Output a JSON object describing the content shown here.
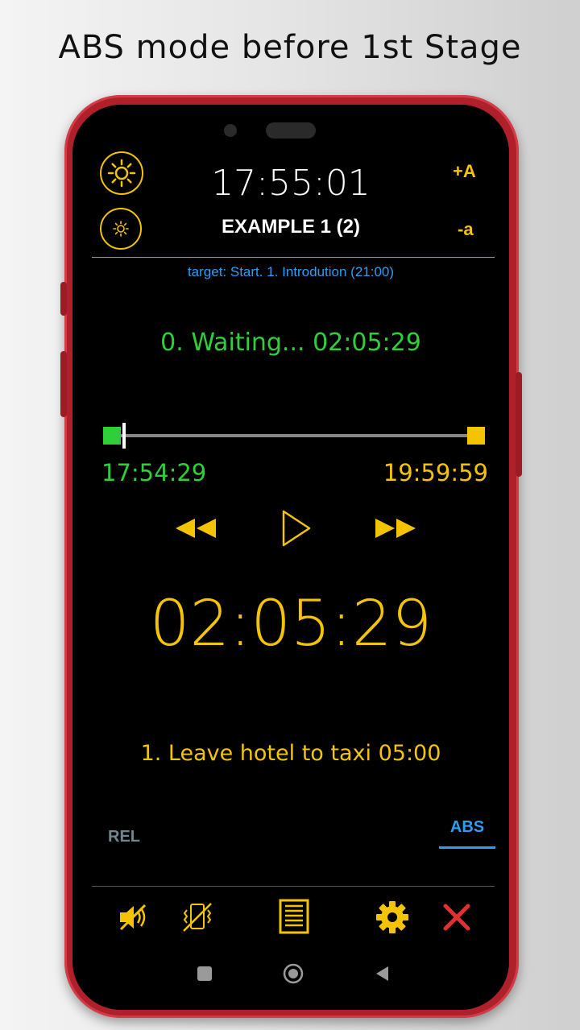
{
  "headline": "ABS mode before 1st Stage",
  "header": {
    "clock": "17:55:01",
    "title": "EXAMPLE 1 (2)",
    "font_increase": "+A",
    "font_decrease": "-a"
  },
  "target_text": "target: Start. 1. Introdution (21:00)",
  "status_text": "0. Waiting... 02:05:29",
  "progress": {
    "start_time": "17:54:29",
    "end_time": "19:59:59",
    "fraction": 0.004
  },
  "countdown": "02:05:29",
  "next_stage": "1. Leave hotel to taxi  05:00",
  "mode_tabs": {
    "rel": "REL",
    "abs": "ABS",
    "selected": "ABS"
  },
  "icons": {
    "brightness_up": "sun-large-icon",
    "brightness_down": "sun-small-icon",
    "rewind": "rewind-icon",
    "play": "play-icon",
    "fast_forward": "fast-forward-icon",
    "mute": "speaker-muted-icon",
    "vibrate_off": "vibrate-off-icon",
    "list": "list-icon",
    "settings": "gear-icon",
    "close": "close-icon"
  },
  "colors": {
    "accent": "#f5c400",
    "green": "#2fcf3a",
    "blue": "#2a9df4",
    "close": "#e03030",
    "case": "#b0202a"
  }
}
